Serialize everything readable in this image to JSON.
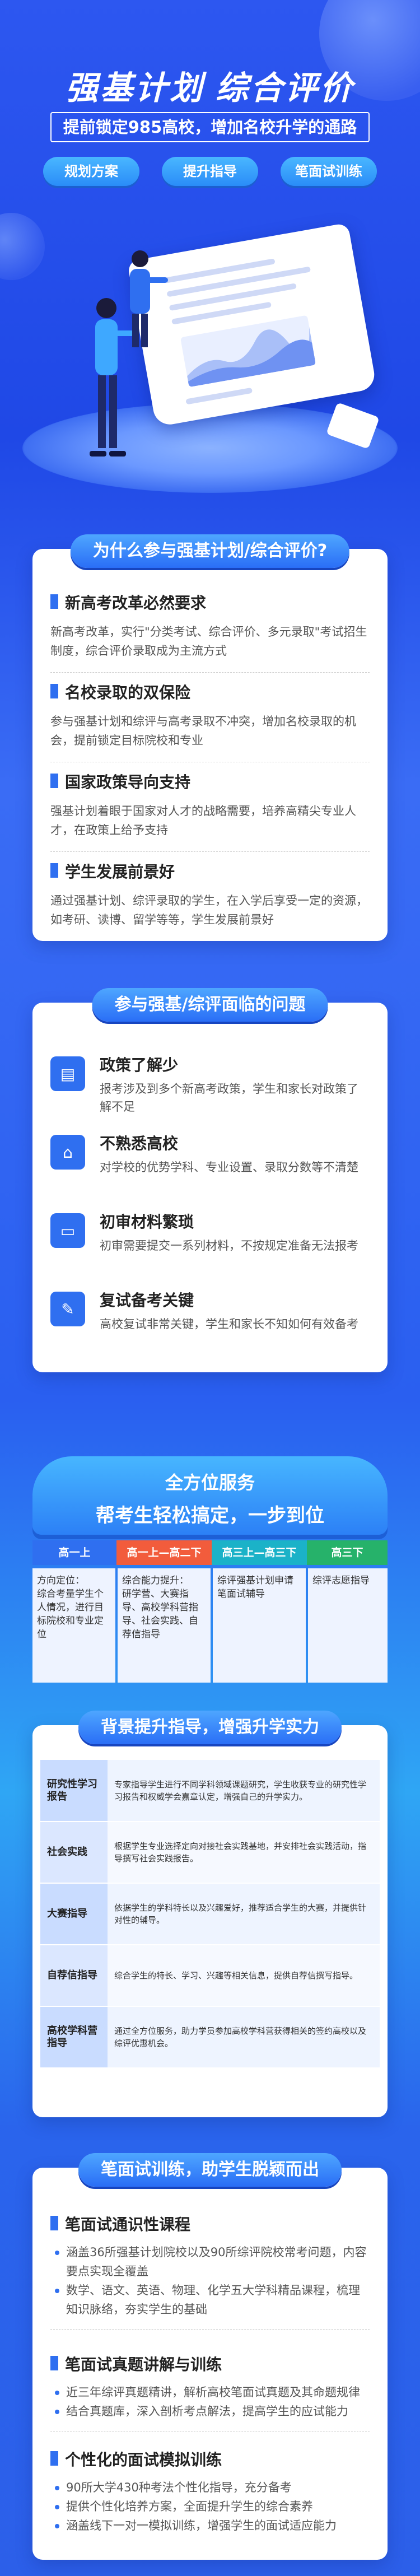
{
  "hero": {
    "title": "强基计划  综合评价",
    "subtitle": "提前锁定985高校，增加名校升学的通路",
    "pills": [
      "规划方案",
      "提升指导",
      "笔面试训练"
    ]
  },
  "why": {
    "heading": "为什么参与强基计划/综合评价?",
    "items": [
      {
        "title": "新高考改革必然要求",
        "desc": "新高考改革，实行\"分类考试、综合评价、多元录取\"考试招生制度，综合评价录取成为主流方式"
      },
      {
        "title": "名校录取的双保险",
        "desc": "参与强基计划和综评与高考录取不冲突，增加名校录取的机会，提前锁定目标院校和专业"
      },
      {
        "title": "国家政策导向支持",
        "desc": "强基计划着眼于国家对人才的战略需要，培养高精尖专业人才，在政策上给予支持"
      },
      {
        "title": "学生发展前景好",
        "desc": "通过强基计划、综评录取的学生，在入学后享受一定的资源，如考研、读博、留学等等，学生发展前景好"
      }
    ]
  },
  "problems": {
    "heading": "参与强基/综评面临的问题",
    "items": [
      {
        "icon": "policy-icon",
        "title": "政策了解少",
        "desc": "报考涉及到多个新高考政策，学生和家长对政策了解不足"
      },
      {
        "icon": "school-icon",
        "title": "不熟悉高校",
        "desc": "对学校的优势学科、专业设置、录取分数等不清楚"
      },
      {
        "icon": "folder-icon",
        "title": "初审材料繁琐",
        "desc": "初审需要提交一系列材料，不按规定准备无法报考"
      },
      {
        "icon": "edit-icon",
        "title": "复试备考关键",
        "desc": "高校复试非常关键，学生和家长不知如何有效备考"
      }
    ]
  },
  "service": {
    "line1": "全方位服务",
    "line2": "帮考生轻松搞定，一步到位",
    "stages": [
      {
        "label": "高一上",
        "color": "#2f6ff0",
        "content": "方向定位：\n综合考量学生个人情况，进行目标院校和专业定位"
      },
      {
        "label": "高一上—高二下",
        "color": "#f25c3c",
        "content": "综合能力提升：\n研学营、大赛指导、高校学科营指导、社会实践、自荐信指导"
      },
      {
        "label": "高三上—高三下",
        "color": "#1bb2c8",
        "content": "综评强基计划申请\n笔面试辅导"
      },
      {
        "label": "高三下",
        "color": "#26b26a",
        "content": "综评志愿指导"
      }
    ]
  },
  "background": {
    "heading": "背景提升指导，增强升学实力",
    "rows": [
      {
        "key": "研究性学习报告",
        "value": "专家指导学生进行不同学科领域课题研究，学生收获专业的研究性学习报告和权威学会嘉章认定，增强自己的升学实力。"
      },
      {
        "key": "社会实践",
        "value": "根据学生专业选择定向对接社会实践基地，并安排社会实践活动，指导撰写社会实践报告。"
      },
      {
        "key": "大赛指导",
        "value": "依据学生的学科特长以及兴趣爱好，推荐适合学生的大赛，并提供针对性的辅导。"
      },
      {
        "key": "自荐信指导",
        "value": "综合学生的特长、学习、兴趣等相关信息，提供自荐信撰写指导。"
      },
      {
        "key": "高校学科营指导",
        "value": "通过全方位服务，助力学员参加高校学科营获得相关的签约高校以及综评优惠机会。"
      }
    ]
  },
  "training": {
    "heading": "笔面试训练，助学生脱颖而出",
    "items": [
      {
        "title": "笔面试通识性课程",
        "points": [
          "涵盖36所强基计划院校以及90所综评院校常考问题，内容要点实现全覆盖",
          "数学、语文、英语、物理、化学五大学科精品课程，梳理知识脉络，夯实学生的基础"
        ]
      },
      {
        "title": "笔面试真题讲解与训练",
        "points": [
          "近三年综评真题精讲，解析高校笔面试真题及其命题规律",
          "结合真题库，深入剖析考点解法，提高学生的应试能力"
        ]
      },
      {
        "title": "个性化的面试模拟训练",
        "points": [
          "90所大学430种考法个性化指导，充分备考",
          "提供个性化培养方案，全面提升学生的综合素养",
          "涵盖线下一对一模拟训练，增强学生的面试适应能力"
        ]
      }
    ]
  }
}
